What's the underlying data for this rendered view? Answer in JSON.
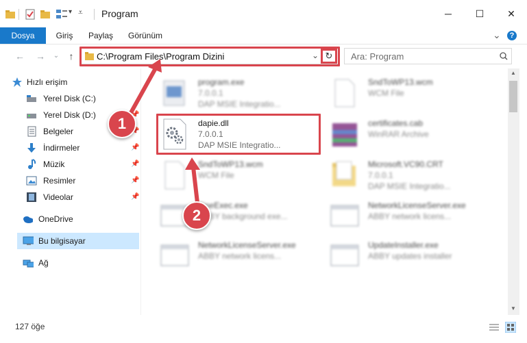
{
  "window": {
    "title": "Program",
    "minimize": "─",
    "maximize": "☐",
    "close": "✕"
  },
  "ribbon": {
    "tabs": [
      "Dosya",
      "Giriş",
      "Paylaş",
      "Görünüm"
    ],
    "expand": "⌄",
    "help": "?"
  },
  "nav": {
    "address": "C:\\Program Files\\Program Dizini",
    "search_placeholder": "Ara: Program"
  },
  "sidebar": {
    "items": [
      {
        "label": "Hızlı erişim",
        "icon": "star-icon"
      },
      {
        "label": "Yerel Disk (C:)",
        "icon": "drive-icon"
      },
      {
        "label": "Yerel Disk (D:)",
        "icon": "drive-icon"
      },
      {
        "label": "Belgeler",
        "icon": "document-icon"
      },
      {
        "label": "İndirmeler",
        "icon": "download-icon"
      },
      {
        "label": "Müzik",
        "icon": "music-icon"
      },
      {
        "label": "Resimler",
        "icon": "pictures-icon"
      },
      {
        "label": "Videolar",
        "icon": "video-icon"
      },
      {
        "label": "OneDrive",
        "icon": "cloud-icon"
      },
      {
        "label": "Bu bilgisayar",
        "icon": "computer-icon"
      },
      {
        "label": "Ağ",
        "icon": "network-icon"
      }
    ]
  },
  "files": [
    {
      "name": "program.exe",
      "line2": "7.0.0.1",
      "line3": "DAP MSIE Integratio..."
    },
    {
      "name": "SndToWP13.wcm",
      "line2": "WCM File",
      "line3": ""
    },
    {
      "name": "dapie.dll",
      "line2": "7.0.0.1",
      "line3": "DAP MSIE Integratio..."
    },
    {
      "name": "certificates.cab",
      "line2": "WinRAR Archive",
      "line3": ""
    },
    {
      "name": "SndToWP13.wcm",
      "line2": "WCM File",
      "line3": ""
    },
    {
      "name": "Microsoft.VC90.CRT",
      "line2": "7.0.0.1",
      "line3": "DAP MSIE Integratio..."
    },
    {
      "name": "FineExec.exe",
      "line2": "ABBY background exe...",
      "line3": ""
    },
    {
      "name": "NetworkLicenseServer.exe",
      "line2": "ABBY network licens...",
      "line3": ""
    },
    {
      "name": "NetworkLicenseServer.exe",
      "line2": "ABBY network licens...",
      "line3": ""
    },
    {
      "name": "UpdateInstaller.exe",
      "line2": "ABBY updates installer",
      "line3": ""
    }
  ],
  "status": {
    "count": "127 öğe"
  },
  "callouts": [
    "1",
    "2"
  ],
  "colors": {
    "accent": "#1979ca",
    "highlight": "#d9454d",
    "selection": "#cce8ff"
  }
}
